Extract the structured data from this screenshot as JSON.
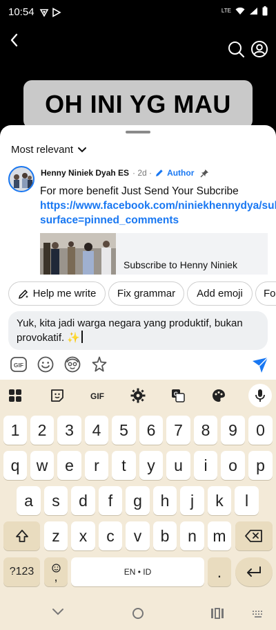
{
  "status_bar": {
    "time": "10:54",
    "network": "LTE"
  },
  "video": {
    "overlay_text": "OH INI YG MAU"
  },
  "comments": {
    "sort_label": "Most relevant",
    "pinned": {
      "author": "Henny Niniek Dyah ES",
      "time": "· 2d ·",
      "badge": "Author",
      "text": "For more benefit Just Send Your Subcribe",
      "link": "https://www.facebook.com/niniekhennydya/subscribenow?surface=pinned_comments",
      "card_title": "Subscribe to Henny Niniek"
    }
  },
  "chips": [
    {
      "label": "Help me write"
    },
    {
      "label": "Fix grammar"
    },
    {
      "label": "Add emoji"
    },
    {
      "label": "Fo"
    }
  ],
  "input": {
    "value": "Yuk, kita jadi warga negara yang produktif, bukan provokatif. ✨"
  },
  "keyboard": {
    "toolbar_gif": "GIF",
    "composer_gif": "GIF",
    "row_numbers": [
      "1",
      "2",
      "3",
      "4",
      "5",
      "6",
      "7",
      "8",
      "9",
      "0"
    ],
    "row1": [
      "q",
      "w",
      "e",
      "r",
      "t",
      "y",
      "u",
      "i",
      "o",
      "p"
    ],
    "row2": [
      "a",
      "s",
      "d",
      "f",
      "g",
      "h",
      "j",
      "k",
      "l"
    ],
    "row3": [
      "z",
      "x",
      "c",
      "v",
      "b",
      "n",
      "m"
    ],
    "symbols_key": "?123",
    "comma_key": ",",
    "space_label": "EN • ID",
    "period_key": "."
  },
  "colors": {
    "accent": "#1877f2",
    "keyboard_bg": "#f3ead8",
    "modifier_key": "#e9dcbf"
  }
}
